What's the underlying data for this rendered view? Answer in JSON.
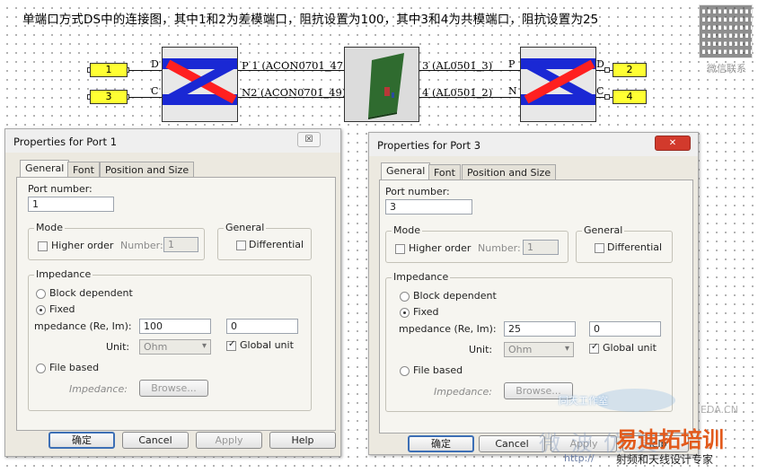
{
  "caption": "单端口方式DS中的连接图，其中1和2为差模端口，阻抗设置为100，其中3和4为共模端口，阻抗设置为25",
  "qr_caption": "微信联系",
  "schematic": {
    "ports": [
      "1",
      "3",
      "2",
      "4"
    ],
    "left_balun_pins": [
      "D",
      "C"
    ],
    "right_balun_pins": [
      "P",
      "N"
    ],
    "right_balun_out": [
      "D",
      "C"
    ],
    "left_signals": [
      "P 1 (ACON0701_47)",
      "N2 (ACON0701_49)"
    ],
    "right_signals": [
      "3 (AL0501_3)",
      "4 (AL0501_2)"
    ]
  },
  "dialogs": [
    {
      "title": "Properties for Port 1",
      "close_label": "☒",
      "tabs": [
        "General",
        "Font",
        "Position and Size"
      ],
      "port_number_label": "Port number:",
      "port_number": "1",
      "mode_title": "Mode",
      "higher_order_label": "Higher order",
      "number_label": "Number:",
      "number_value": "1",
      "general_title": "General",
      "differential_label": "Differential",
      "impedance_title": "Impedance",
      "block_dependent_label": "Block dependent",
      "fixed_label": "Fixed",
      "impedance_label": "mpedance (Re, Im):",
      "impedance_re": "100",
      "impedance_im": "0",
      "unit_label": "Unit:",
      "unit_value": "Ohm",
      "global_unit_label": "Global unit",
      "file_based_label": "File based",
      "impedance_file_label": "Impedance:",
      "browse_label": "Browse...",
      "buttons": [
        "确定",
        "Cancel",
        "Apply",
        "Help"
      ]
    },
    {
      "title": "Properties for Port 3",
      "close_label": "✕",
      "tabs": [
        "General",
        "Font",
        "Position and Size"
      ],
      "port_number_label": "Port number:",
      "port_number": "3",
      "mode_title": "Mode",
      "higher_order_label": "Higher order",
      "number_label": "Number:",
      "number_value": "1",
      "general_title": "General",
      "differential_label": "Differential",
      "impedance_title": "Impedance",
      "block_dependent_label": "Block dependent",
      "fixed_label": "Fixed",
      "impedance_label": "mpedance (Re, Im):",
      "impedance_re": "25",
      "impedance_im": "0",
      "unit_label": "Unit:",
      "unit_value": "Ohm",
      "global_unit_label": "Global unit",
      "file_based_label": "File based",
      "impedance_file_label": "Impedance:",
      "browse_label": "Browse...",
      "buttons": [
        "确定",
        "Cancel",
        "Apply",
        "Help"
      ]
    }
  ],
  "watermarks": {
    "brand_faint": "微波仿真",
    "brand_orange": "易迪拓培训",
    "brand_top": "同天工作室",
    "site": "EDA.CN",
    "url": "http://",
    "slogan": "射频和天线设计专家"
  },
  "colors": {
    "port_fill": "#ffff33",
    "balun_blue": "#1a28d4",
    "balun_red": "#ff2020",
    "pcb_green": "#2f6b2f"
  }
}
